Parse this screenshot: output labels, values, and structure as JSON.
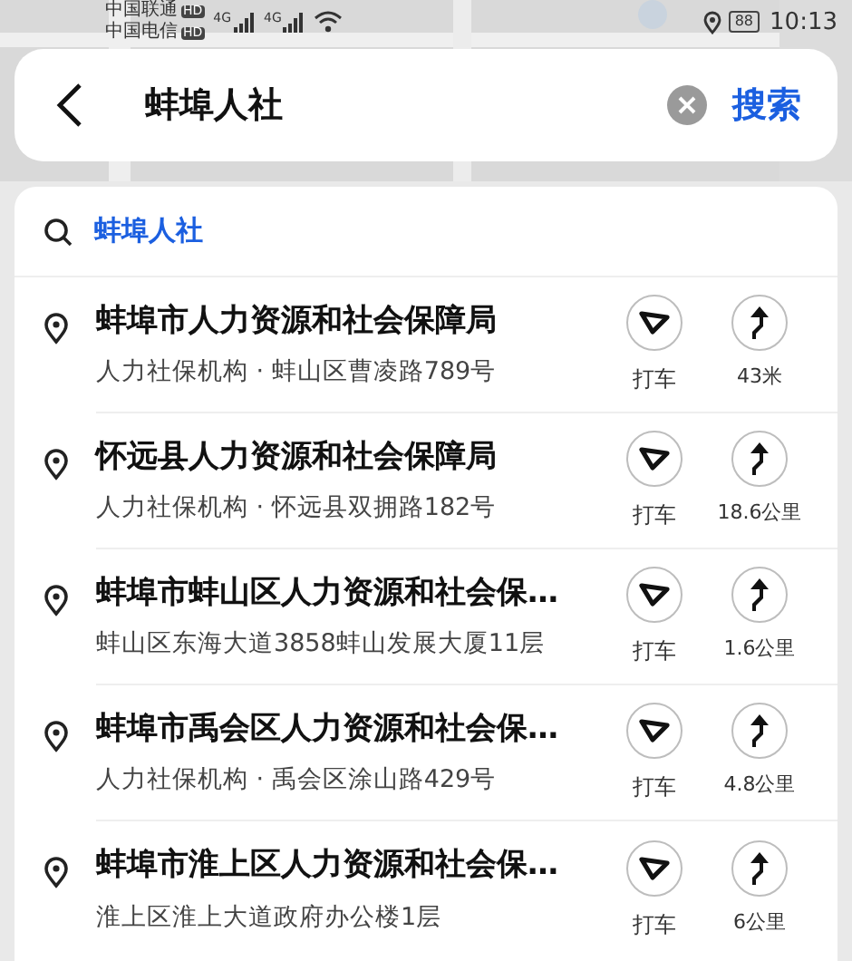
{
  "status_bar": {
    "carriers": [
      {
        "name": "中国联通",
        "badge": "HD"
      },
      {
        "name": "中国电信",
        "badge": "HD"
      }
    ],
    "signals": [
      "4G",
      "4G"
    ],
    "battery": "88",
    "time": "10:13"
  },
  "search": {
    "value": "蚌埠人社",
    "submit": "搜索"
  },
  "suggestion": "蚌埠人社",
  "results": [
    {
      "title": "蚌埠市人力资源和社会保障局",
      "subtitle": "人力社保机构 · 蚌山区曹凌路789号",
      "taxi": "打车",
      "distance": "43米"
    },
    {
      "title": "怀远县人力资源和社会保障局",
      "subtitle": "人力社保机构 · 怀远县双拥路182号",
      "taxi": "打车",
      "distance": "18.6公里"
    },
    {
      "title": "蚌埠市蚌山区人力资源和社会保…",
      "subtitle": "蚌山区东海大道3858蚌山发展大厦11层",
      "taxi": "打车",
      "distance": "1.6公里"
    },
    {
      "title": "蚌埠市禹会区人力资源和社会保…",
      "subtitle": "人力社保机构 · 禹会区涂山路429号",
      "taxi": "打车",
      "distance": "4.8公里"
    },
    {
      "title": "蚌埠市淮上区人力资源和社会保…",
      "subtitle": "淮上区淮上大道政府办公楼1层",
      "taxi": "打车",
      "distance": "6公里"
    }
  ]
}
